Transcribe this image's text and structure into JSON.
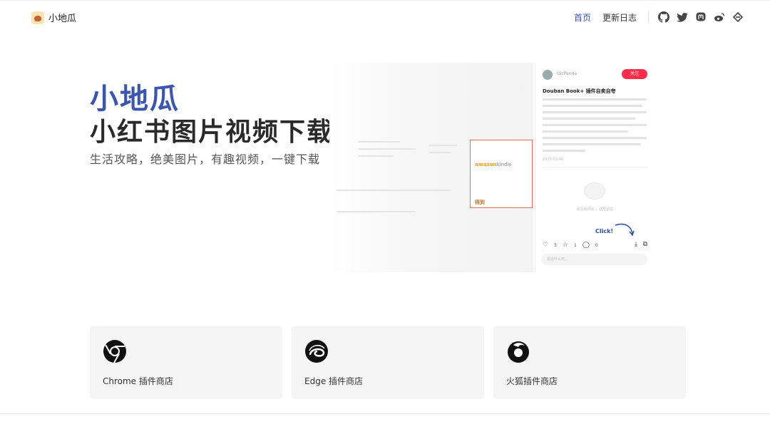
{
  "header": {
    "brand": "小地瓜",
    "nav": [
      {
        "label": "首页",
        "active": true
      },
      {
        "label": "更新日志",
        "active": false
      }
    ],
    "social_icons": [
      "github-icon",
      "twitter-icon",
      "mastodon-icon",
      "weibo-icon",
      "link-icon"
    ],
    "accent_color": "#3a55b4"
  },
  "hero": {
    "title": "小地瓜",
    "subtitle": "小红书图片视频下载助手",
    "tagline": "生活攻略，绝美图片，有趣视频，一键下载"
  },
  "preview": {
    "username": "OicPanda",
    "follow": "关注",
    "post_title": "Douban Book+ 插件自卖自夸",
    "date": "2023-03-06",
    "empty_comment": "还没有评论 ，这里留言",
    "click_hint": "Click!",
    "likes": "5",
    "stars": "1",
    "comments": "0",
    "comment_placeholder": "说点什么吧...",
    "amazon_text": "amazon",
    "kindle_text": "kindle",
    "badge_text": "得到"
  },
  "stores": [
    {
      "label": "Chrome 插件商店",
      "icon": "chrome-icon"
    },
    {
      "label": "Edge 插件商店",
      "icon": "edge-icon"
    },
    {
      "label": "火狐插件商店",
      "icon": "firefox-icon"
    }
  ]
}
